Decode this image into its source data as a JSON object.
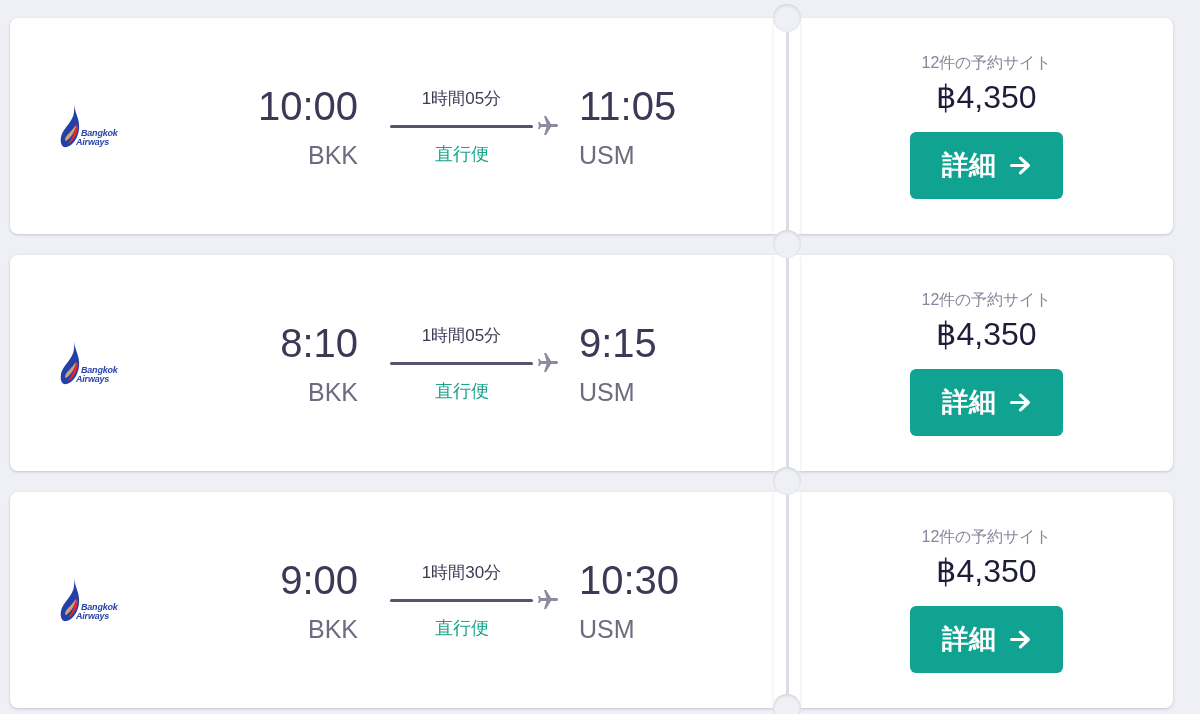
{
  "flights": [
    {
      "airline_logo": {
        "lines": [
          "Bangkok",
          "Airways"
        ]
      },
      "departure": {
        "time": "10:00",
        "airport": "BKK"
      },
      "duration": "1時間05分",
      "stops": "直行便",
      "arrival": {
        "time": "11:05",
        "airport": "USM"
      },
      "offers": "12件の予約サイト",
      "price": "฿4,350",
      "button": "詳細"
    },
    {
      "airline_logo": {
        "lines": [
          "Bangkok",
          "Airways"
        ]
      },
      "departure": {
        "time": "8:10",
        "airport": "BKK"
      },
      "duration": "1時間05分",
      "stops": "直行便",
      "arrival": {
        "time": "9:15",
        "airport": "USM"
      },
      "offers": "12件の予約サイト",
      "price": "฿4,350",
      "button": "詳細"
    },
    {
      "airline_logo": {
        "lines": [
          "Bangkok",
          "Airways"
        ]
      },
      "departure": {
        "time": "9:00",
        "airport": "BKK"
      },
      "duration": "1時間30分",
      "stops": "直行便",
      "arrival": {
        "time": "10:30",
        "airport": "USM"
      },
      "offers": "12件の予約サイト",
      "price": "฿4,350",
      "button": "詳細"
    }
  ]
}
